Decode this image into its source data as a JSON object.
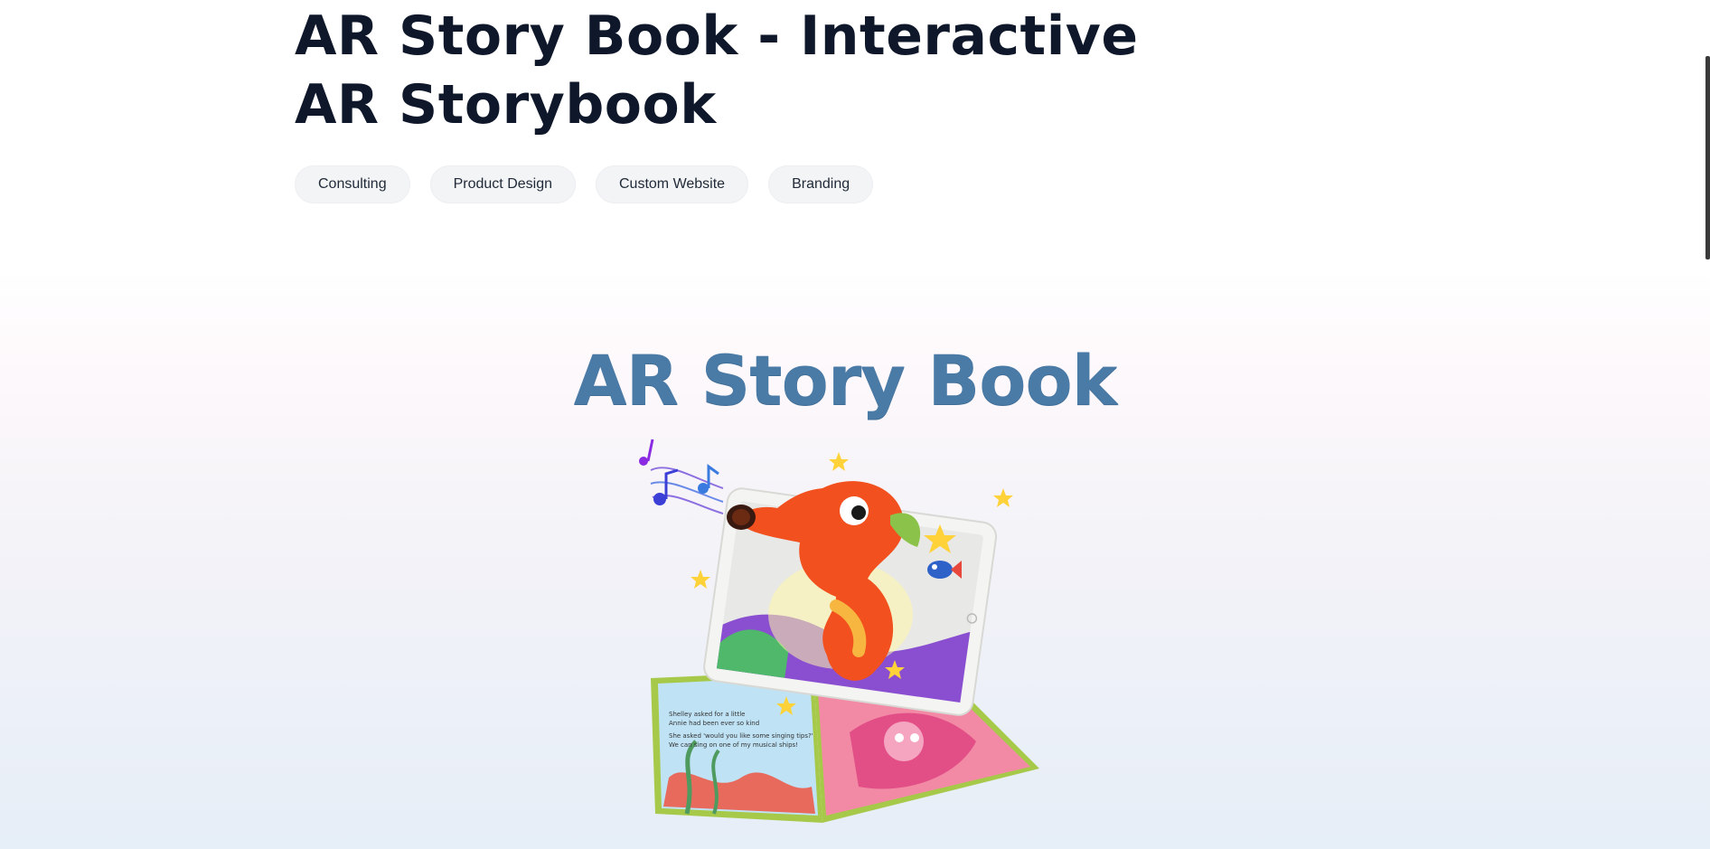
{
  "page": {
    "title": "AR Story Book - Interactive AR Storybook"
  },
  "tags": [
    "Consulting",
    "Product Design",
    "Custom Website",
    "Branding"
  ],
  "hero": {
    "title": "AR Story Book",
    "image_alt": "Seahorse character emerging from a tablet above an open storybook",
    "book_text_line1": "Shelley asked for a little",
    "book_text_line2": "Annie had been ever so kind",
    "book_text_line3": "She asked 'would you like some singing tips?'",
    "book_text_line4": "We can sing on one of my musical ships!"
  },
  "colors": {
    "title": "#0f172a",
    "hero_title": "#4a7aa6",
    "tag_bg": "#f3f4f6"
  }
}
